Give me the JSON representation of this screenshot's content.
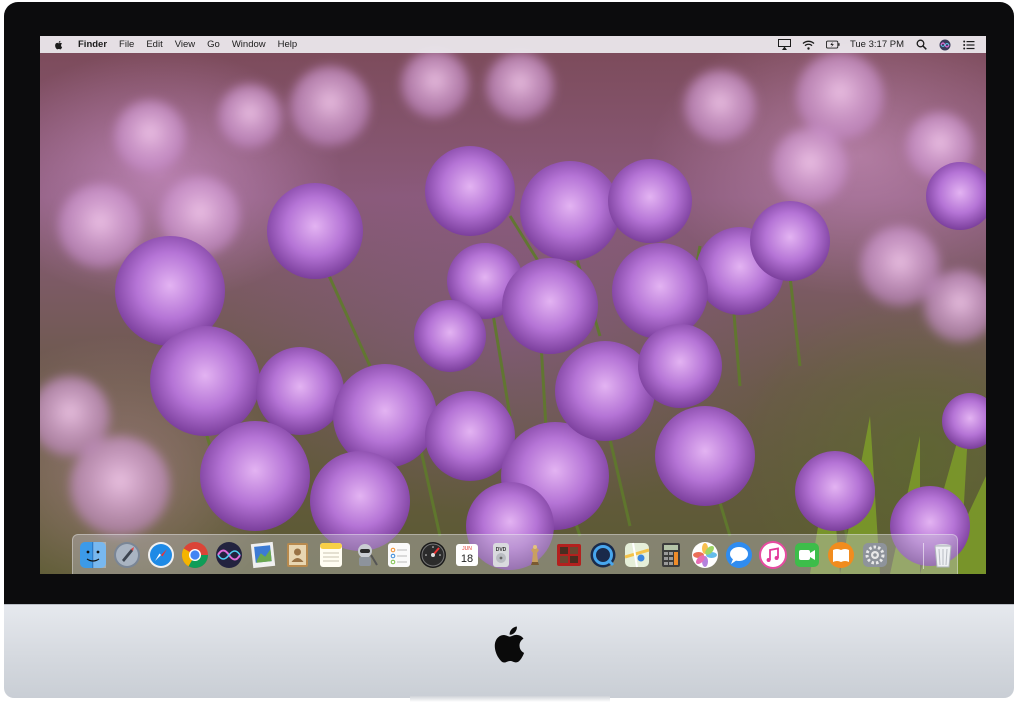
{
  "menubar": {
    "items": [
      "Finder",
      "File",
      "Edit",
      "View",
      "Go",
      "Window",
      "Help"
    ],
    "clock": "Tue 3:17 PM",
    "status_icons": [
      "airplay-icon",
      "wifi-icon",
      "battery-icon",
      "clock",
      "spotlight-icon",
      "siri-icon",
      "notification-center-icon"
    ]
  },
  "dock": {
    "calendar": {
      "month": "JUN",
      "day": "18"
    },
    "dvd_label": "DVD",
    "apps": [
      "finder-icon",
      "launchpad-icon",
      "safari-icon",
      "chrome-icon",
      "siri-icon",
      "preview-icon",
      "contacts-icon",
      "notes-icon",
      "automator-icon",
      "reminders-icon",
      "dashboard-icon",
      "calendar-icon",
      "dvd-player-icon",
      "chess-icon",
      "photo-booth-icon",
      "quicktime-icon",
      "maps-icon",
      "calculator-icon",
      "photos-icon",
      "messages-icon",
      "itunes-icon",
      "facetime-icon",
      "ibooks-icon",
      "system-preferences-icon",
      "trash-icon"
    ]
  },
  "colors": {
    "menubar_bg": "#eeecf0",
    "wallpaper_flower": "#b070d0",
    "bezel": "#0c0c0d",
    "chin": "#d9dde2"
  }
}
